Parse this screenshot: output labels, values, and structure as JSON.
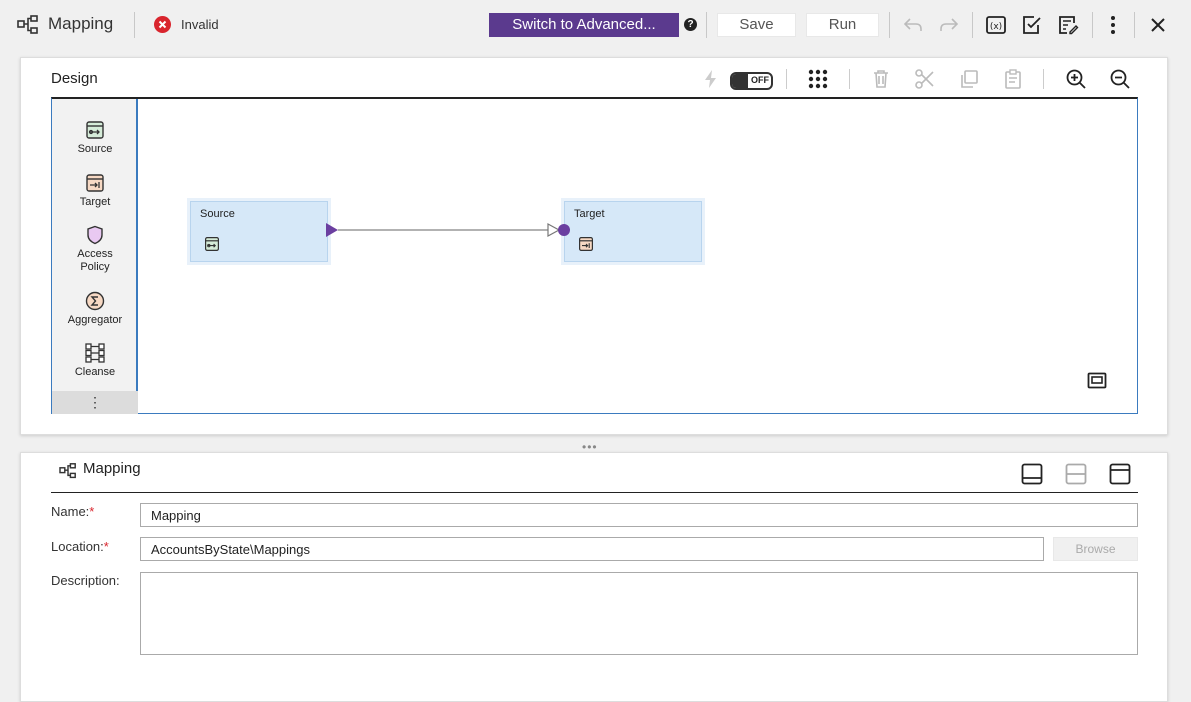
{
  "header": {
    "title": "Mapping",
    "status": "Invalid",
    "switch_label": "Switch to Advanced...",
    "help_glyph": "?",
    "save_label": "Save",
    "run_label": "Run",
    "icons": [
      "mapping-icon",
      "invalid-icon",
      "help-icon",
      "undo-icon",
      "redo-icon",
      "parameters-icon",
      "validate-icon",
      "properties-icon",
      "more-vertical-icon",
      "close-icon"
    ]
  },
  "design": {
    "title": "Design",
    "auto_toggle": "OFF",
    "toolbar_icons": [
      "lightning-icon",
      "toggle",
      "arrange-grid-icon",
      "delete-icon",
      "cut-icon",
      "copy-icon",
      "paste-icon",
      "zoom-in-icon",
      "zoom-out-icon"
    ],
    "palette": [
      {
        "label": "Source",
        "icon": "source-icon"
      },
      {
        "label": "Target",
        "icon": "target-icon"
      },
      {
        "label": "Access Policy",
        "icon": "access-policy-icon"
      },
      {
        "label": "Aggregator",
        "icon": "aggregator-icon"
      },
      {
        "label": "Cleanse",
        "icon": "cleanse-icon"
      }
    ],
    "palette_more": "⋮",
    "nodes": [
      {
        "title": "Source",
        "icon": "source-icon"
      },
      {
        "title": "Target",
        "icon": "target-icon"
      }
    ]
  },
  "splitter": "•••",
  "properties": {
    "title": "Mapping",
    "fields": {
      "name_label": "Name:",
      "name_value": "Mapping",
      "location_label": "Location:",
      "location_value": "AccountsByState\\Mappings",
      "browse_label": "Browse",
      "description_label": "Description:",
      "description_value": ""
    },
    "required_mark": "*"
  },
  "colors": {
    "accent_purple": "#5b3a8e",
    "invalid_red": "#d9252d",
    "canvas_border": "#3b7bbf",
    "node_fill": "#d6e8f8"
  }
}
